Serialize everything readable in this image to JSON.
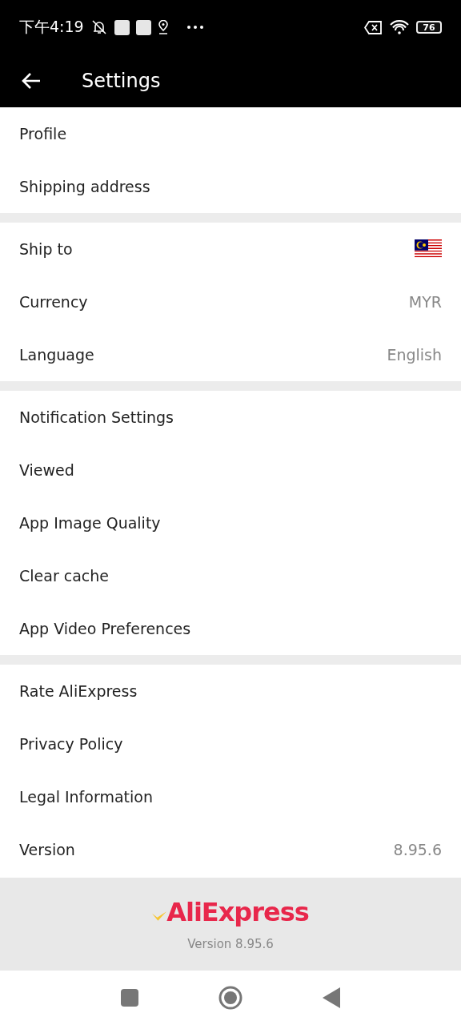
{
  "status_bar": {
    "time": "下午4:19",
    "battery": "76"
  },
  "header": {
    "title": "Settings"
  },
  "groups": [
    {
      "items": [
        {
          "label": "Profile",
          "kind": "plain"
        },
        {
          "label": "Shipping address",
          "kind": "plain"
        }
      ]
    },
    {
      "items": [
        {
          "label": "Ship to",
          "kind": "flag"
        },
        {
          "label": "Currency",
          "kind": "value",
          "value": "MYR"
        },
        {
          "label": "Language",
          "kind": "value",
          "value": "English"
        }
      ]
    },
    {
      "items": [
        {
          "label": "Notification Settings",
          "kind": "plain"
        },
        {
          "label": "Viewed",
          "kind": "plain"
        },
        {
          "label": "App Image Quality",
          "kind": "plain"
        },
        {
          "label": "Clear cache",
          "kind": "plain"
        },
        {
          "label": "App Video Preferences",
          "kind": "plain"
        }
      ]
    },
    {
      "items": [
        {
          "label": "Rate AliExpress",
          "kind": "plain"
        },
        {
          "label": "Privacy Policy",
          "kind": "plain"
        },
        {
          "label": "Legal Information",
          "kind": "plain"
        },
        {
          "label": "Version",
          "kind": "value",
          "value": "8.95.6"
        }
      ]
    }
  ],
  "footer": {
    "logo": "AliExpress",
    "version": "Version 8.95.6"
  }
}
